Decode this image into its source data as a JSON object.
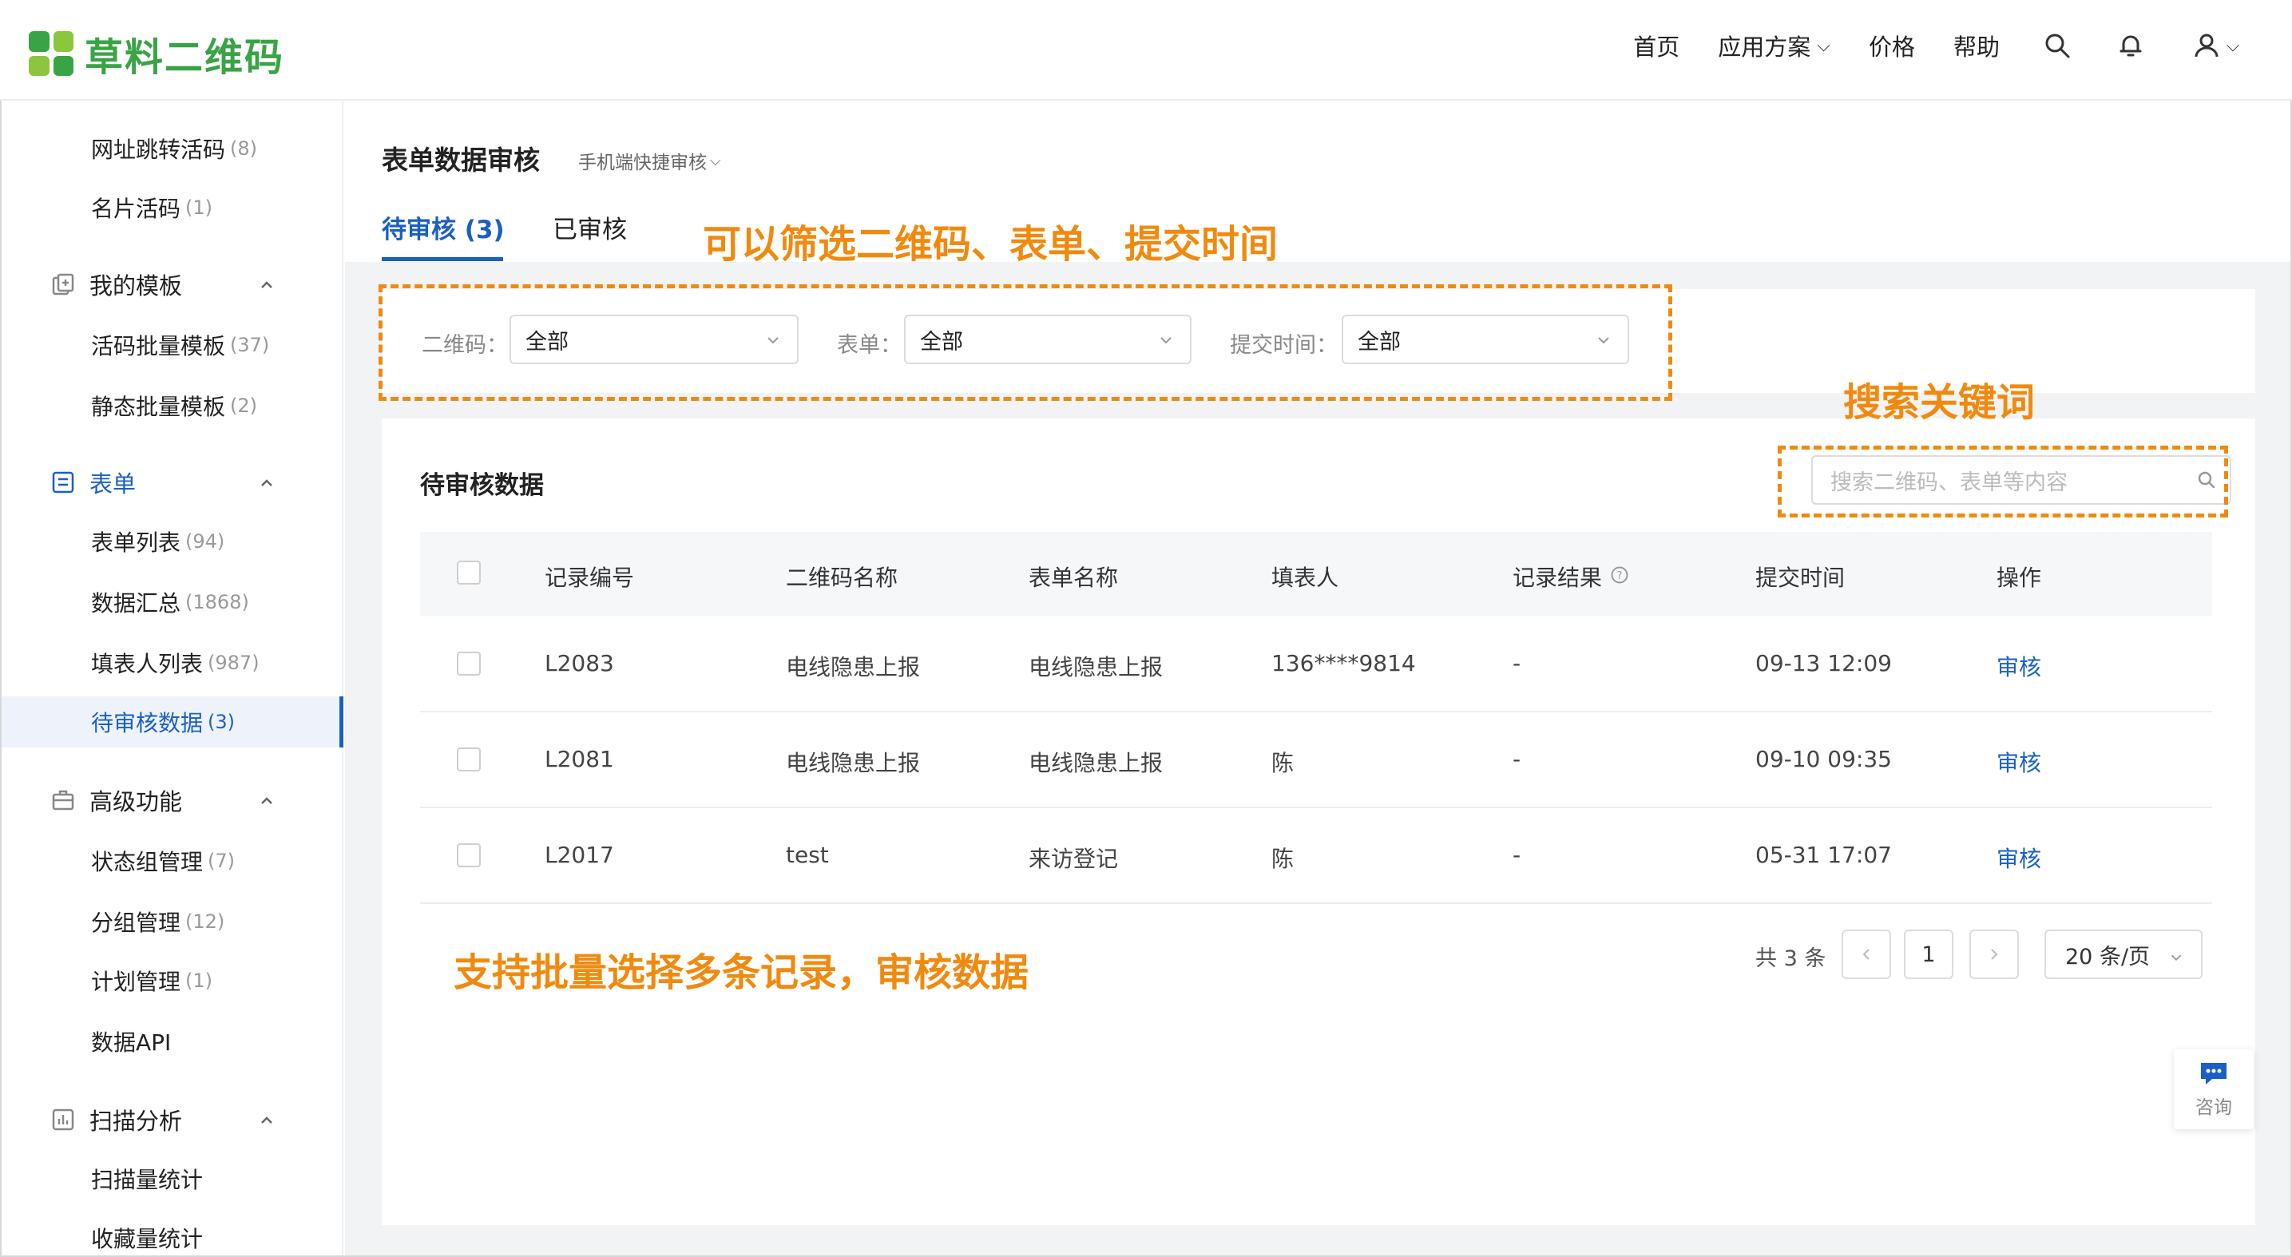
{
  "header": {
    "logo_text": "草料二维码",
    "nav": [
      "首页",
      "应用方案",
      "价格",
      "帮助"
    ],
    "brand_color": "#3aa346",
    "accent_color": "#1a5fc4"
  },
  "sidebar": {
    "items": [
      {
        "label": "网址跳转活码",
        "count": "(8)"
      },
      {
        "label": "名片活码",
        "count": "(1)"
      }
    ],
    "groups": [
      {
        "label": "我的模板",
        "items": [
          {
            "label": "活码批量模板",
            "count": "(37)"
          },
          {
            "label": "静态批量模板",
            "count": "(2)"
          }
        ]
      },
      {
        "label": "表单",
        "items": [
          {
            "label": "表单列表",
            "count": "(94)"
          },
          {
            "label": "数据汇总",
            "count": "(1868)"
          },
          {
            "label": "填表人列表",
            "count": "(987)"
          },
          {
            "label": "待审核数据",
            "count": "(3)"
          }
        ]
      },
      {
        "label": "高级功能",
        "items": [
          {
            "label": "状态组管理",
            "count": "(7)"
          },
          {
            "label": "分组管理",
            "count": "(12)"
          },
          {
            "label": "计划管理",
            "count": "(1)"
          },
          {
            "label": "数据API",
            "count": ""
          }
        ]
      },
      {
        "label": "扫描分析",
        "items": [
          {
            "label": "扫描量统计",
            "count": ""
          },
          {
            "label": "收藏量统计",
            "count": ""
          }
        ]
      }
    ]
  },
  "main": {
    "title": "表单数据审核",
    "subtitle": "手机端快捷审核",
    "tabs": [
      {
        "label": "待审核 (3)"
      },
      {
        "label": "已审核"
      }
    ],
    "filters": [
      {
        "label": "二维码：",
        "value": "全部"
      },
      {
        "label": "表单：",
        "value": "全部"
      },
      {
        "label": "提交时间：",
        "value": "全部"
      }
    ],
    "card_title": "待审核数据",
    "search_placeholder": "搜索二维码、表单等内容",
    "columns": [
      "记录编号",
      "二维码名称",
      "表单名称",
      "填表人",
      "记录结果",
      "提交时间",
      "操作"
    ],
    "rows": [
      {
        "id": "L2083",
        "qr": "电线隐患上报",
        "form": "电线隐患上报",
        "person": "136****9814",
        "result": "-",
        "time": "09-13 12:09",
        "action": "审核"
      },
      {
        "id": "L2081",
        "qr": "电线隐患上报",
        "form": "电线隐患上报",
        "person": "陈",
        "result": "-",
        "time": "09-10 09:35",
        "action": "审核"
      },
      {
        "id": "L2017",
        "qr": "test",
        "form": "来访登记",
        "person": "陈",
        "result": "-",
        "time": "05-31 17:07",
        "action": "审核"
      }
    ],
    "pagination": {
      "total_text": "共 3 条",
      "page": "1",
      "page_size": "20 条/页"
    }
  },
  "annotations": {
    "filter_note": "可以筛选二维码、表单、提交时间",
    "search_note": "搜索关键词",
    "batch_note": "支持批量选择多条记录，审核数据",
    "color": "#f08a0f"
  },
  "consult": {
    "label": "咨询"
  }
}
